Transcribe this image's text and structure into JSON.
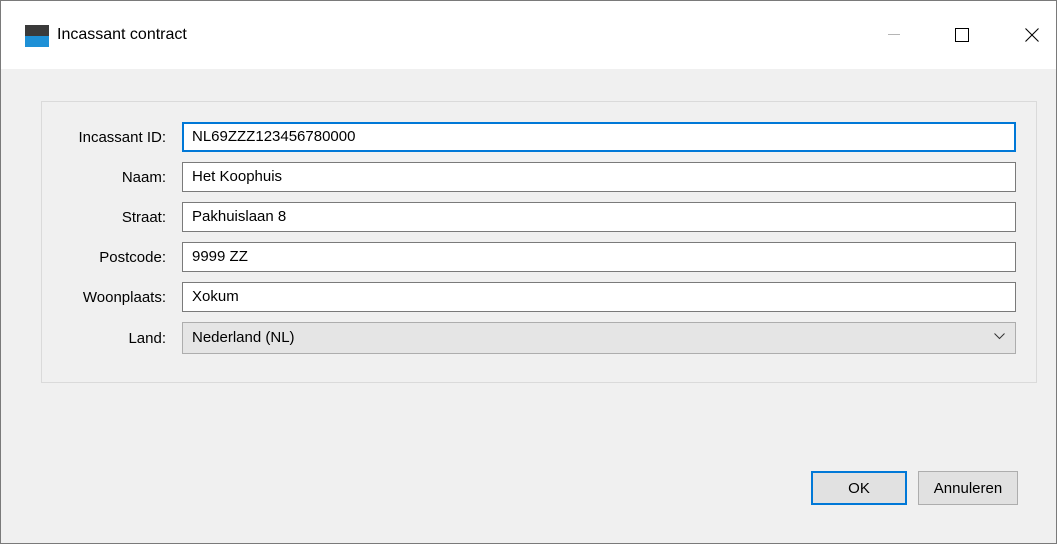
{
  "window": {
    "title": "Incassant contract",
    "icon": "app-icon",
    "controls": [
      "minimize-icon",
      "maximize-icon",
      "close-icon"
    ]
  },
  "form": {
    "fields": [
      {
        "label": "Incassant ID:",
        "value": "NL69ZZZ123456780000"
      },
      {
        "label": "Naam:",
        "value": "Het Koophuis"
      },
      {
        "label": "Straat:",
        "value": "Pakhuislaan 8"
      },
      {
        "label": "Postcode:",
        "value": "9999 ZZ"
      },
      {
        "label": "Woonplaats:",
        "value": "Xokum"
      }
    ],
    "country": {
      "label": "Land:",
      "value": "Nederland (NL)"
    }
  },
  "buttons": {
    "ok": "OK",
    "cancel": "Annuleren"
  },
  "colors": {
    "accent": "#0078d7",
    "icon_top": "#3a3a3a",
    "icon_bottom": "#1e90d6"
  }
}
